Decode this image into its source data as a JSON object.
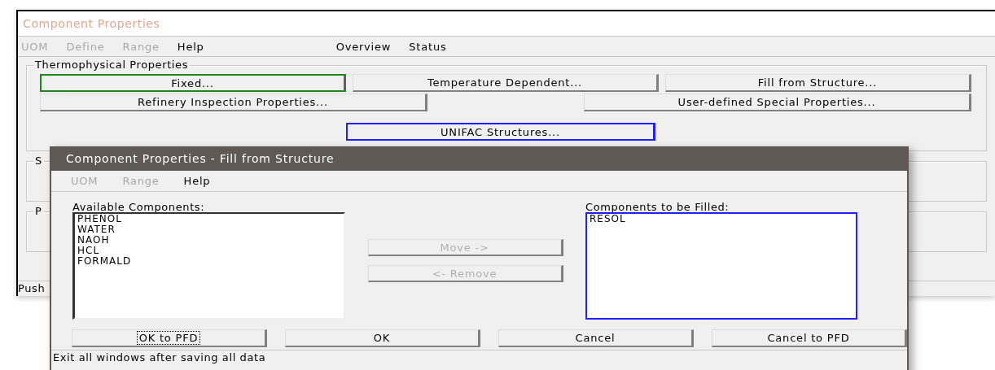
{
  "window": {
    "title": "Component Properties",
    "active": false
  },
  "menu": [
    {
      "label": "UOM",
      "disabled": true
    },
    {
      "label": "Define",
      "disabled": true
    },
    {
      "label": "Range",
      "disabled": true
    },
    {
      "label": "Help",
      "disabled": false
    },
    {
      "label": "Overview",
      "disabled": false
    },
    {
      "label": "Status",
      "disabled": false
    }
  ],
  "thermophysical": {
    "title": "Thermophysical Properties",
    "buttons": [
      {
        "label": "Fixed...",
        "focused": true
      },
      {
        "label": "Temperature Dependent...",
        "focused": false
      },
      {
        "label": "Fill from Structure...",
        "focused": false
      },
      {
        "label": "Refinery Inspection Properties...",
        "focused": false
      },
      {
        "label": "User-defined Special Properties...",
        "focused": false
      },
      {
        "label": "UNIFAC Structures...",
        "focused": true
      }
    ]
  },
  "groups": [
    {
      "title": "S"
    },
    {
      "title": "P"
    }
  ],
  "status_bar": "Push",
  "dialog": {
    "title": "Component Properties - Fill from Structure",
    "menu": [
      {
        "label": "UOM",
        "disabled": true
      },
      {
        "label": "Range",
        "disabled": true
      },
      {
        "label": "Help",
        "disabled": false
      }
    ],
    "available": {
      "label": "Available Components:",
      "focused": false,
      "items": [
        "PHENOL",
        "WATER",
        "NAOH",
        "HCL",
        "FORMALD"
      ]
    },
    "move_buttons": [
      {
        "label": "Move ->",
        "disabled": true
      },
      {
        "label": "<- Remove",
        "disabled": true
      }
    ],
    "filled": {
      "label": "Components to be Filled:",
      "focused": true,
      "items": [
        "RESOL"
      ]
    },
    "buttons": [
      {
        "label": "OK to PFD",
        "focused": true
      },
      {
        "label": "OK",
        "focused": false
      },
      {
        "label": "Cancel",
        "focused": false
      },
      {
        "label": "Cancel to PFD",
        "focused": false
      }
    ],
    "status_bar": "Exit all windows after saving all data"
  }
}
